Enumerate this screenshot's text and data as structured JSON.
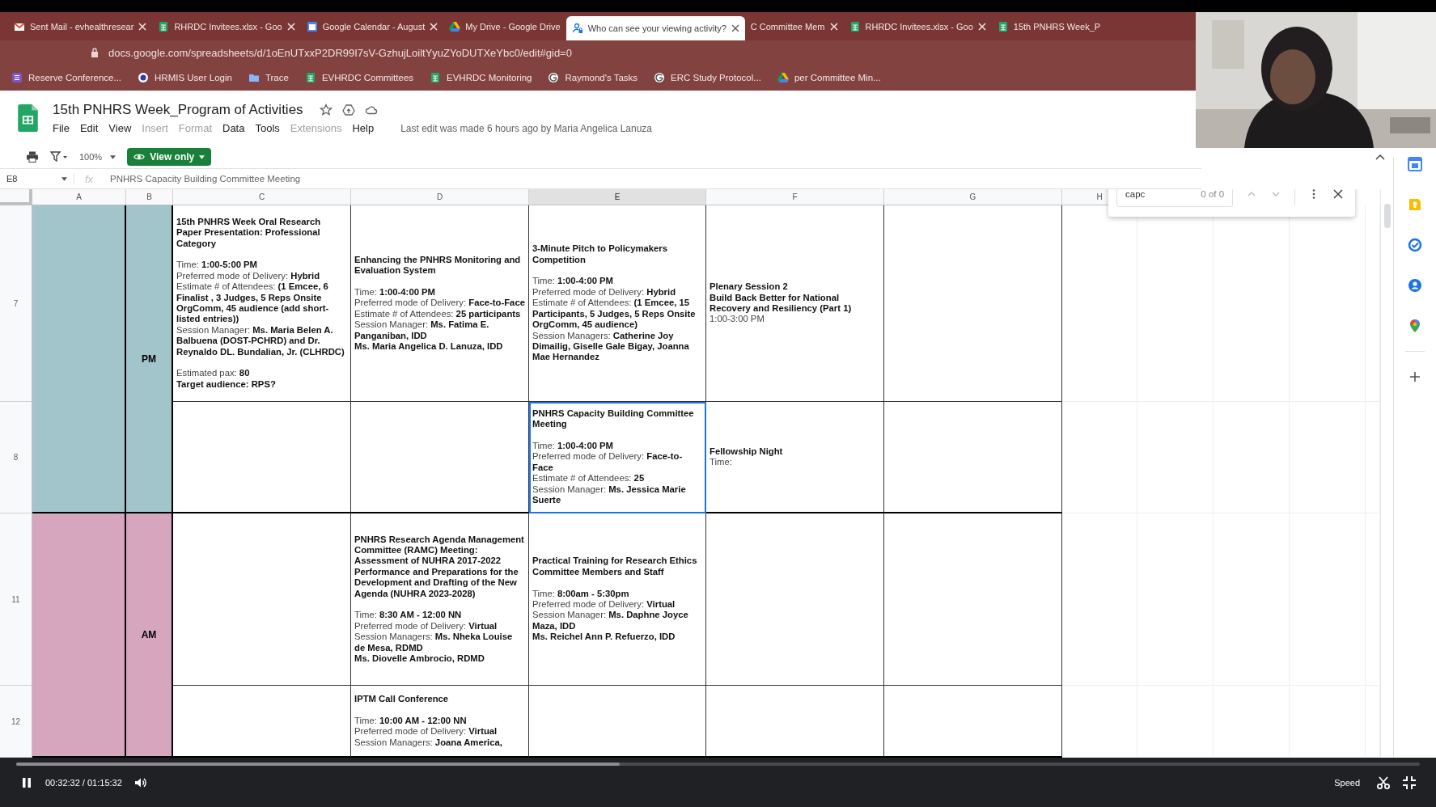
{
  "browser": {
    "tabs": [
      {
        "title": "Sent Mail - evhealthresear",
        "kind": "mail",
        "selected": false,
        "closable": true
      },
      {
        "title": "RHRDC Invitees.xlsx - Goo",
        "kind": "sheets",
        "selected": false,
        "closable": true
      },
      {
        "title": "Google Calendar - August",
        "kind": "calendar",
        "selected": false,
        "closable": true
      },
      {
        "title": "My Drive - Google Drive",
        "kind": "drive",
        "selected": false,
        "closable": false
      },
      {
        "title": "Who can see your viewing activity?",
        "kind": "privacy",
        "selected": true,
        "closable": true
      },
      {
        "title": "C Committee Mem",
        "kind": "none",
        "selected": false,
        "closable": true
      },
      {
        "title": "RHRDC Invitees.xlsx - Goo",
        "kind": "sheets",
        "selected": false,
        "closable": true
      },
      {
        "title": "15th PNHRS Week_P",
        "kind": "sheets",
        "selected": false,
        "closable": false
      }
    ],
    "address": "docs.google.com/spreadsheets/d/1oEnUTxxP2DR99I7sV-GzhujLoiltYyuZYoDUTXeYbc0/edit#gid=0",
    "bookmarks": [
      {
        "label": "Reserve Conference...",
        "kind": "list"
      },
      {
        "label": "HRMIS User Login",
        "kind": "seal"
      },
      {
        "label": "Trace",
        "kind": "folder"
      },
      {
        "label": "EVHRDC Committees",
        "kind": "sheets"
      },
      {
        "label": "EVHRDC Monitoring",
        "kind": "sheets"
      },
      {
        "label": "Raymond's Tasks",
        "kind": "google"
      },
      {
        "label": "ERC Study Protocol...",
        "kind": "google"
      },
      {
        "label": "per Committee Min...",
        "kind": "drive"
      }
    ]
  },
  "document": {
    "title": "15th PNHRS Week_Program of Activities",
    "menu": [
      {
        "label": "File",
        "disabled": false
      },
      {
        "label": "Edit",
        "disabled": false
      },
      {
        "label": "View",
        "disabled": false
      },
      {
        "label": "Insert",
        "disabled": true
      },
      {
        "label": "Format",
        "disabled": true
      },
      {
        "label": "Data",
        "disabled": false
      },
      {
        "label": "Tools",
        "disabled": false
      },
      {
        "label": "Extensions",
        "disabled": true
      },
      {
        "label": "Help",
        "disabled": false
      }
    ],
    "last_edit": "Last edit was made 6 hours ago by Maria Angelica Lanuza",
    "zoom": "100%",
    "mode_button": "View only"
  },
  "formula_bar": {
    "cell": "E8",
    "function_label": "fx",
    "content": "PNHRS Capacity Building Committee Meeting"
  },
  "sheet": {
    "columns": [
      {
        "label": "A",
        "selected": false
      },
      {
        "label": "B",
        "selected": false
      },
      {
        "label": "C",
        "selected": false
      },
      {
        "label": "D",
        "selected": false
      },
      {
        "label": "E",
        "selected": true
      },
      {
        "label": "F",
        "selected": false
      },
      {
        "label": "G",
        "selected": false
      },
      {
        "label": "H",
        "selected": false
      }
    ],
    "groups": [
      {
        "period": "PM",
        "color": "#a2c4cb",
        "rows": [
          {
            "number": "7",
            "cells": [
              {
                "selected": false,
                "blocks": [
                  [
                    "**15th PNHRS Week Oral Research Paper Presentation: Professional Category**"
                  ],
                  [
                    "Time: **1:00-5:00 PM**",
                    "Preferred mode of Delivery: **Hybrid**",
                    "Estimate # of Attendees: **(1 Emcee, 6 Finalist , 3 Judges, 5 Reps Onsite OrgComm, 45 audience (add short-listed entries))**",
                    "Session Manager: **Ms. Maria Belen A. Balbuena (DOST-PCHRD) and Dr. Reynaldo DL. Bundalian, Jr. (CLHRDC)**"
                  ],
                  [
                    "Estimated pax: **80**",
                    "**Target audience: RPS?**"
                  ]
                ]
              },
              {
                "selected": false,
                "blocks": [
                  [
                    "**Enhancing the PNHRS Monitoring and Evaluation System**"
                  ],
                  [
                    "Time: **1:00-4:00 PM**",
                    "Preferred mode of Delivery: **Face-to-Face**",
                    "Estimate # of Attendees: **25 participants**",
                    "Session Manager: **Ms. Fatima E. Panganiban, IDD**",
                    "**Ms. Maria Angelica D. Lanuza, IDD**"
                  ]
                ]
              },
              {
                "selected": false,
                "blocks": [
                  [
                    "**3-Minute Pitch to Policymakers Competition**"
                  ],
                  [
                    "Time: **1:00-4:00 PM**",
                    "Preferred mode of Delivery: **Hybrid**",
                    "Estimate # of Attendees: **(1 Emcee, 15 Participants, 5 Judges, 5 Reps Onsite OrgComm, 45 audience)**",
                    "Session Managers: **Catherine Joy Dimailig, Giselle Gale Bigay, Joanna Mae Hernandez**"
                  ]
                ]
              },
              {
                "selected": false,
                "blocks": [
                  [
                    "**Plenary Session 2**",
                    "**Build Back Better for National Recovery and Resiliency (Part 1)**",
                    "1:00-3:00 PM"
                  ]
                ]
              },
              {
                "selected": false
              }
            ]
          },
          {
            "number": "8",
            "cells": [
              {
                "selected": false
              },
              {
                "selected": false
              },
              {
                "selected": true,
                "blocks": [
                  [
                    "**PNHRS Capacity Building Committee Meeting**"
                  ],
                  [
                    "Time: **1:00-4:00 PM**",
                    "Preferred mode of Delivery: **Face-to-Face**",
                    "Estimate # of Attendees: **25**",
                    "Session Manager: **Ms. Jessica Marie Suerte**"
                  ]
                ]
              },
              {
                "selected": false,
                "blocks": [
                  [
                    "**Fellowship Night**",
                    "Time:"
                  ]
                ]
              },
              {
                "selected": false
              }
            ]
          }
        ]
      },
      {
        "period": "AM",
        "color": "#d5a6bd",
        "rows": [
          {
            "number": "11",
            "cells": [
              {
                "selected": false
              },
              {
                "selected": false,
                "blocks": [
                  [
                    "**PNHRS Research Agenda Management Committee (RAMC) Meeting: Assessment of NUHRA 2017-2022 Performance and Preparations for the Development and Drafting of the New Agenda (NUHRA 2023-2028)**"
                  ],
                  [
                    "Time: **8:30 AM - 12:00 NN**",
                    "Preferred mode of Delivery:  **Virtual**",
                    "Session Managers: **Ms. Nheka Louise de Mesa, RDMD**",
                    "**Ms. Diovelle Ambrocio, RDMD**"
                  ]
                ]
              },
              {
                "selected": false,
                "blocks": [
                  [
                    "**Practical Training for Research Ethics Committee Members and Staff**"
                  ],
                  [
                    "Time: **8:00am - 5:30pm**",
                    "Preferred mode of Delivery: **Virtual**",
                    "Session Manager: **Ms. Daphne Joyce Maza, IDD**",
                    "**Ms. Reichel Ann P. Refuerzo, IDD**"
                  ]
                ]
              },
              {
                "selected": false
              },
              {
                "selected": false
              }
            ]
          },
          {
            "number": "12",
            "cells": [
              {
                "selected": false
              },
              {
                "selected": false,
                "blocks": [
                  [
                    "**IPTM Call Conference**"
                  ],
                  [
                    "Time: **10:00 AM - 12:00 NN**",
                    "Preferred mode of Delivery: **Virtual**",
                    "Session Managers: **Joana America,**"
                  ]
                ]
              },
              {
                "selected": false
              },
              {
                "selected": false
              },
              {
                "selected": false
              }
            ]
          }
        ]
      }
    ]
  },
  "find": {
    "query": "capc",
    "count": "0 of 0"
  },
  "player": {
    "playing": true,
    "time": "00:32:32 / 01:15:32",
    "level": 0.43,
    "speed_label": "Speed"
  }
}
